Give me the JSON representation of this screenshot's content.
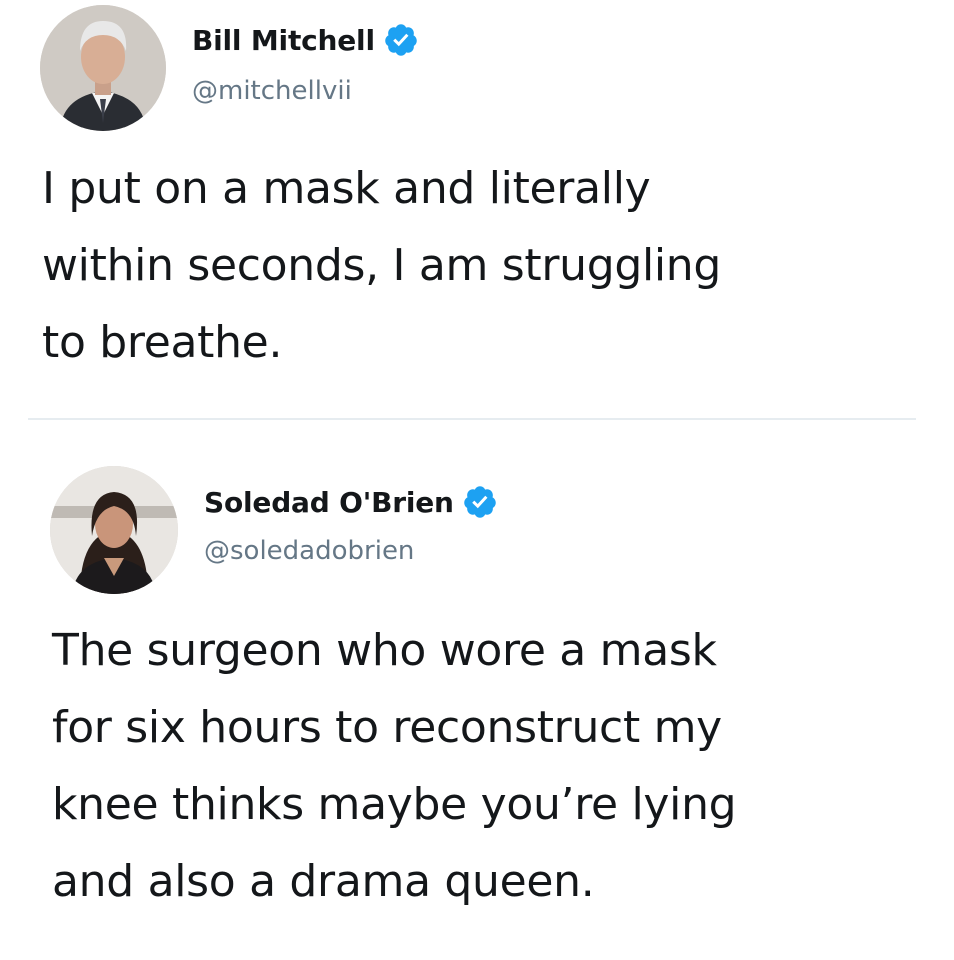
{
  "tweets": [
    {
      "author": {
        "name": "Bill Mitchell",
        "handle": "@mitchellvii",
        "verified": true
      },
      "text": "I put on a mask and literally\nwithin seconds, I am struggling\nto breathe."
    },
    {
      "author": {
        "name": "Soledad O'Brien",
        "handle": "@soledadobrien",
        "verified": true
      },
      "text": "The surgeon who wore a mask\nfor six hours to reconstruct my\nknee thinks maybe you’re lying\nand also a drama queen."
    }
  ],
  "icons": {
    "verified": "verified-badge-icon"
  },
  "colors": {
    "verified_blue": "#1da1f2",
    "handle_gray": "#657786",
    "text": "#14171a",
    "divider": "#e6ecf0"
  }
}
